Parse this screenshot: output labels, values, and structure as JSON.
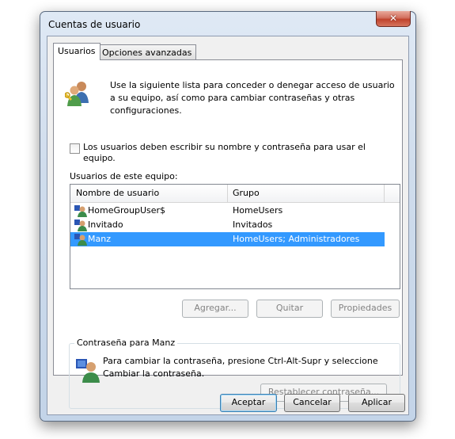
{
  "window": {
    "title": "Cuentas de usuario",
    "close_label": "✕"
  },
  "tabs": [
    {
      "label": "Usuarios",
      "active": true
    },
    {
      "label": "Opciones avanzadas",
      "active": false
    }
  ],
  "intro": {
    "text": "Use la siguiente lista para conceder o denegar acceso de usuario a su equipo, así como para cambiar contraseñas y otras configuraciones.",
    "icon": "users-icon"
  },
  "require_login": {
    "label": "Los usuarios deben escribir su nombre y contraseña para usar el equipo.",
    "checked": false
  },
  "users_list": {
    "caption": "Usuarios de este equipo:",
    "columns": [
      "Nombre de usuario",
      "Grupo"
    ],
    "rows": [
      {
        "name": "HomeGroupUser$",
        "group": "HomeUsers",
        "selected": false
      },
      {
        "name": "Invitado",
        "group": "Invitados",
        "selected": false
      },
      {
        "name": "Manz",
        "group": "HomeUsers; Administradores",
        "selected": true
      }
    ]
  },
  "list_buttons": {
    "add": "Agregar...",
    "remove": "Quitar",
    "properties": "Propiedades"
  },
  "password_group": {
    "title": "Contraseña para Manz",
    "text": "Para cambiar la contraseña, presione Ctrl-Alt-Supr y seleccione Cambiar la contraseña.",
    "reset_button": "Restablecer contraseña..."
  },
  "footer": {
    "ok": "Aceptar",
    "cancel": "Cancelar",
    "apply": "Aplicar"
  },
  "colors": {
    "selection": "#3399ff",
    "close": "#c7432c",
    "title_bar": "#cfdcec"
  }
}
